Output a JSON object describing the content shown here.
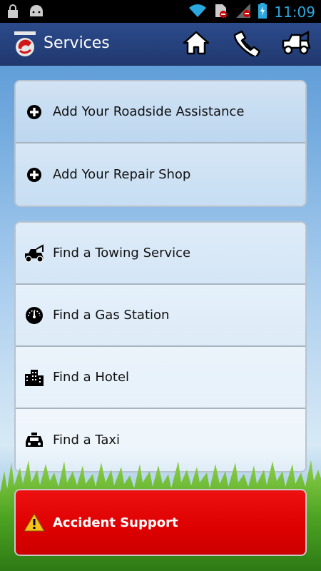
{
  "status_bar": {
    "time": "11:09",
    "icons": [
      "lock-icon",
      "android-icon",
      "wifi-icon",
      "sim-blocked-icon",
      "signal-icon",
      "battery-charging-icon"
    ]
  },
  "header": {
    "title": "Services",
    "logo": "app-logo",
    "actions": [
      "home-icon",
      "phone-handset-icon",
      "tow-truck-icon"
    ]
  },
  "groups": [
    {
      "items": [
        {
          "label": "Add Your Roadside Assistance",
          "icon": "plus-circle-icon"
        },
        {
          "label": "Add Your Repair Shop",
          "icon": "plus-circle-icon"
        }
      ]
    },
    {
      "items": [
        {
          "label": "Find a Towing Service",
          "icon": "tow-truck-icon"
        },
        {
          "label": "Find a Gas Station",
          "icon": "fuel-gauge-icon"
        },
        {
          "label": "Find a Hotel",
          "icon": "hotel-building-icon"
        },
        {
          "label": "Find a Taxi",
          "icon": "taxi-icon"
        }
      ]
    }
  ],
  "accident_button": {
    "label": "Accident Support",
    "icon": "warning-icon",
    "color": "#dd1111"
  },
  "colors": {
    "header_bg": "#253f7a",
    "time": "#2aa9e0"
  }
}
